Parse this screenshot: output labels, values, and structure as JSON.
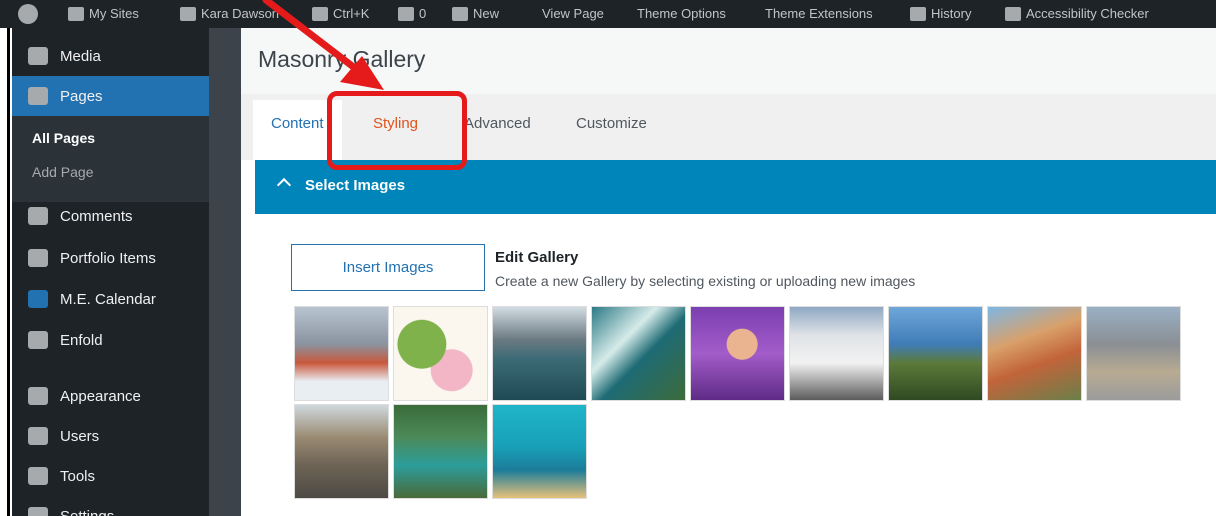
{
  "admin_bar": {
    "items": [
      {
        "label": "",
        "icon": "wordpress-icon"
      },
      {
        "label": "My Sites",
        "icon": "sites-icon"
      },
      {
        "label": "Kara Dawson",
        "icon": "home-icon"
      },
      {
        "label": "Ctrl+K",
        "icon": "search-icon"
      },
      {
        "label": "0",
        "icon": "comment-icon"
      },
      {
        "label": "New",
        "icon": "plus-icon"
      },
      {
        "label": "View Page",
        "icon": ""
      },
      {
        "label": "Theme Options",
        "icon": ""
      },
      {
        "label": "Theme Extensions",
        "icon": ""
      },
      {
        "label": "History",
        "icon": "history-icon"
      },
      {
        "label": "Accessibility Checker",
        "icon": "accessibility-icon"
      }
    ]
  },
  "sidebar": {
    "items": [
      {
        "label": "Media",
        "icon": "media-icon"
      },
      {
        "label": "Pages",
        "icon": "pages-icon"
      },
      {
        "label": "Comments",
        "icon": "comments-icon"
      },
      {
        "label": "Portfolio Items",
        "icon": "portfolio-icon"
      },
      {
        "label": "M.E. Calendar",
        "icon": "calendar-icon"
      },
      {
        "label": "Enfold",
        "icon": "enfold-icon"
      },
      {
        "label": "Appearance",
        "icon": "appearance-icon"
      },
      {
        "label": "Users",
        "icon": "users-icon"
      },
      {
        "label": "Tools",
        "icon": "tools-icon"
      },
      {
        "label": "Settings",
        "icon": "settings-icon"
      }
    ],
    "submenu": [
      "All Pages",
      "Add Page"
    ]
  },
  "editor": {
    "title": "Masonry Gallery",
    "tabs": [
      "Content",
      "Styling",
      "Advanced",
      "Customize"
    ],
    "active_tab": "Content",
    "highlighted_tab": "Styling",
    "section": "Select Images",
    "insert_button": "Insert Images",
    "edit_gallery_title": "Edit Gallery",
    "edit_gallery_desc": "Create a new Gallery by selecting existing or uploading new images"
  },
  "gallery": [
    "children-in-snow",
    "cactus-axolotl",
    "lake-mountains",
    "ocean-coast",
    "girl-with-tablet",
    "modern-building",
    "daisies-by-sea",
    "city-river-aerial",
    "louvre-pyramid",
    "eiffel-street",
    "forest-river",
    "underwater-cartoon"
  ],
  "colors": {
    "admin_dark": "#1d2327",
    "accent_blue": "#2271b1",
    "section_blue": "#0085ba",
    "styling_orange": "#e0531c",
    "annotation_red": "#e51b1b"
  }
}
